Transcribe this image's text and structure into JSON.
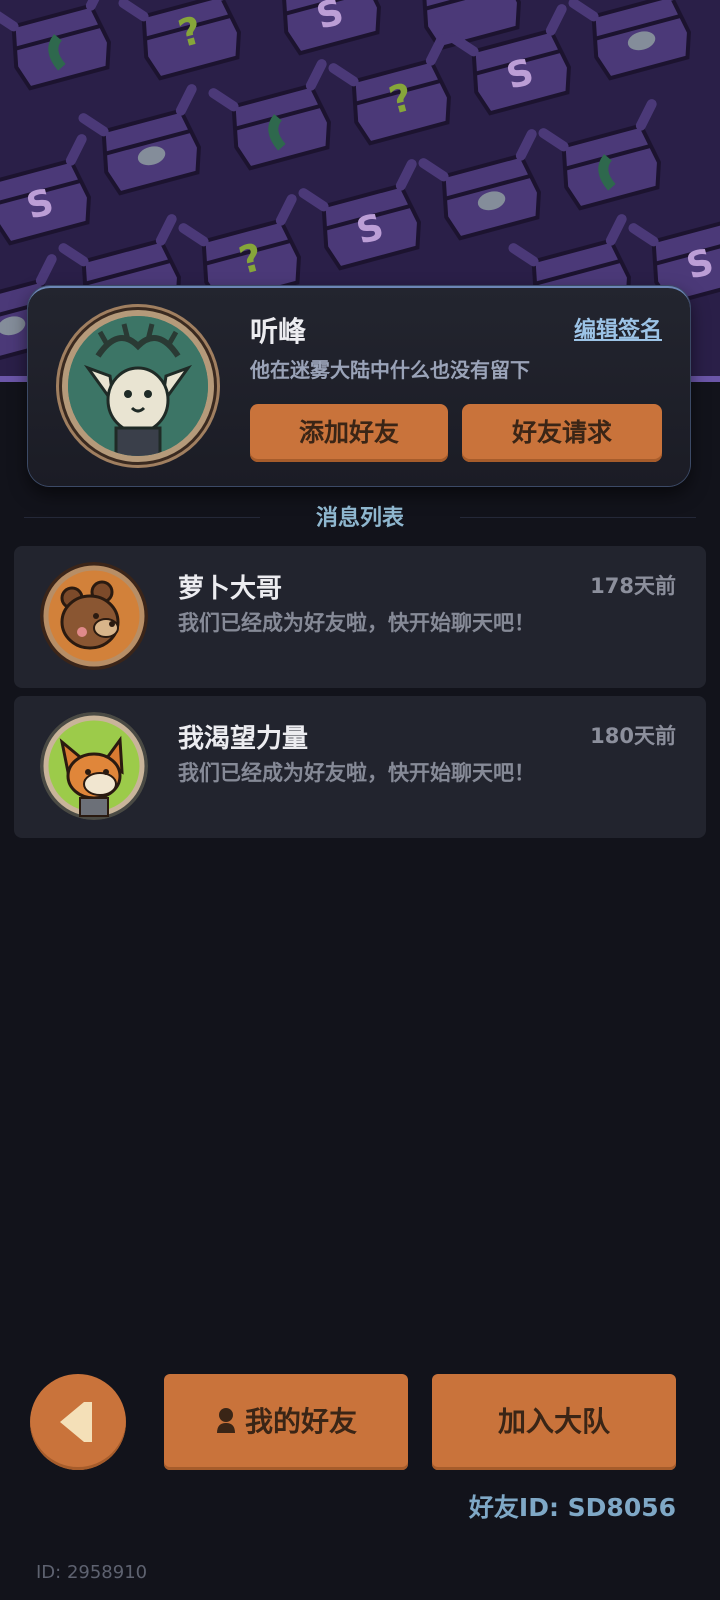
{
  "profile": {
    "name": "听峰",
    "edit_sign_label": "编辑签名",
    "signature": "他在迷雾大陆中什么也没有留下",
    "add_friend_label": "添加好友",
    "friend_request_label": "好友请求"
  },
  "message_list": {
    "title": "消息列表",
    "items": [
      {
        "name": "萝卜大哥",
        "time": "178天前",
        "text": "我们已经成为好友啦，快开始聊天吧！",
        "avatar_icon": "bear-avatar-icon"
      },
      {
        "name": "我渴望力量",
        "time": "180天前",
        "text": "我们已经成为好友啦，快开始聊天吧！",
        "avatar_icon": "fox-avatar-icon"
      }
    ]
  },
  "bottom": {
    "my_friends_label": "我的好友",
    "join_team_label": "加入大队",
    "friend_id": "好友ID: SD8056",
    "user_id": "ID: 2958910"
  },
  "colors": {
    "accent_orange": "#c9733b",
    "background": "#12131b",
    "banner": "#2a1f48",
    "card": "#22242e",
    "link_blue": "#9cc3e6"
  }
}
